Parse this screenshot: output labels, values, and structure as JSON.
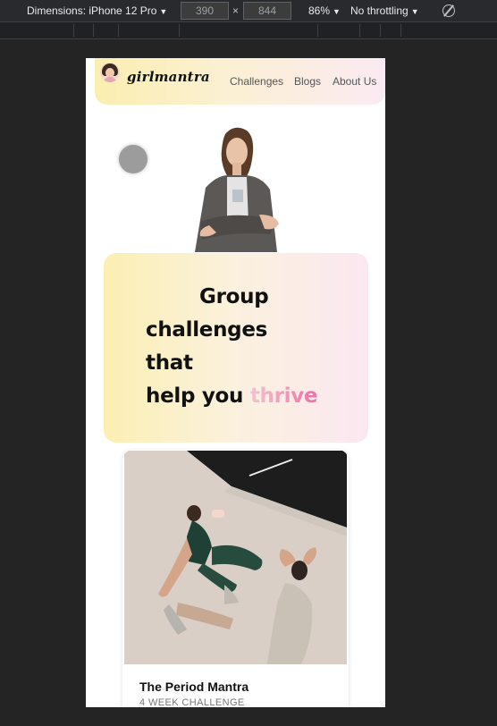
{
  "devtools": {
    "dimensions_label": "Dimensions: iPhone 12 Pro",
    "width": "390",
    "height": "844",
    "times": "×",
    "zoom": "86%",
    "throttling": "No throttling"
  },
  "navbar": {
    "logo_text": "girlmantra",
    "links": [
      "Challenges",
      "Blogs",
      "About Us"
    ]
  },
  "hero": {
    "line1": "Group",
    "line2": "challenges",
    "line3": "that",
    "line4_prefix": "help you ",
    "line4_highlight": "thrive"
  },
  "challenge_card": {
    "title": "The Period Mantra",
    "subtitle": "4 WEEK CHALLENGE"
  },
  "colors": {
    "highlight_start": "#f3c3cf",
    "highlight_end": "#f06fa7",
    "hero_gradient_left": "#fbefb3",
    "hero_gradient_right": "#fbe7f1"
  }
}
